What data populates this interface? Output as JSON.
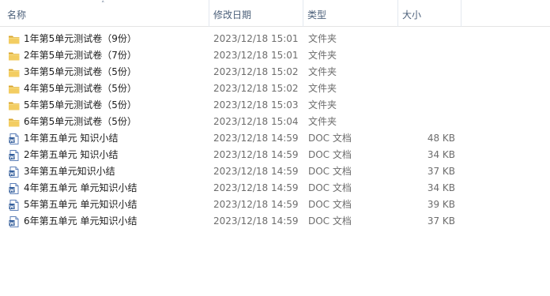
{
  "header": {
    "name": "名称",
    "date": "修改日期",
    "type": "类型",
    "size": "大小",
    "sort_indicator": "˄"
  },
  "rows": [
    {
      "icon": "folder-icon",
      "name": "1年第5单元测试卷（9份）",
      "date": "2023/12/18 15:01",
      "type": "文件夹",
      "size": ""
    },
    {
      "icon": "folder-icon",
      "name": "2年第5单元测试卷（7份）",
      "date": "2023/12/18 15:01",
      "type": "文件夹",
      "size": ""
    },
    {
      "icon": "folder-icon",
      "name": "3年第5单元测试卷（5份）",
      "date": "2023/12/18 15:02",
      "type": "文件夹",
      "size": ""
    },
    {
      "icon": "folder-icon",
      "name": "4年第5单元测试卷（5份）",
      "date": "2023/12/18 15:02",
      "type": "文件夹",
      "size": ""
    },
    {
      "icon": "folder-icon",
      "name": "5年第5单元测试卷（5份）",
      "date": "2023/12/18 15:03",
      "type": "文件夹",
      "size": ""
    },
    {
      "icon": "folder-icon",
      "name": "6年第5单元测试卷（5份）",
      "date": "2023/12/18 15:04",
      "type": "文件夹",
      "size": ""
    },
    {
      "icon": "word-doc-icon",
      "name": "1年第五单元 知识小结",
      "date": "2023/12/18 14:59",
      "type": "DOC 文档",
      "size": "48 KB"
    },
    {
      "icon": "word-doc-icon",
      "name": "2年第五单元 知识小结",
      "date": "2023/12/18 14:59",
      "type": "DOC 文档",
      "size": "34 KB"
    },
    {
      "icon": "word-doc-icon",
      "name": "3年第五单元知识小结",
      "date": "2023/12/18 14:59",
      "type": "DOC 文档",
      "size": "37 KB"
    },
    {
      "icon": "word-doc-icon",
      "name": "4年第五单元 单元知识小结",
      "date": "2023/12/18 14:59",
      "type": "DOC 文档",
      "size": "34 KB"
    },
    {
      "icon": "word-doc-icon",
      "name": "5年第五单元 单元知识小结",
      "date": "2023/12/18 14:59",
      "type": "DOC 文档",
      "size": "39 KB"
    },
    {
      "icon": "word-doc-icon",
      "name": "6年第五单元 单元知识小结",
      "date": "2023/12/18 14:59",
      "type": "DOC 文档",
      "size": "37 KB"
    }
  ]
}
